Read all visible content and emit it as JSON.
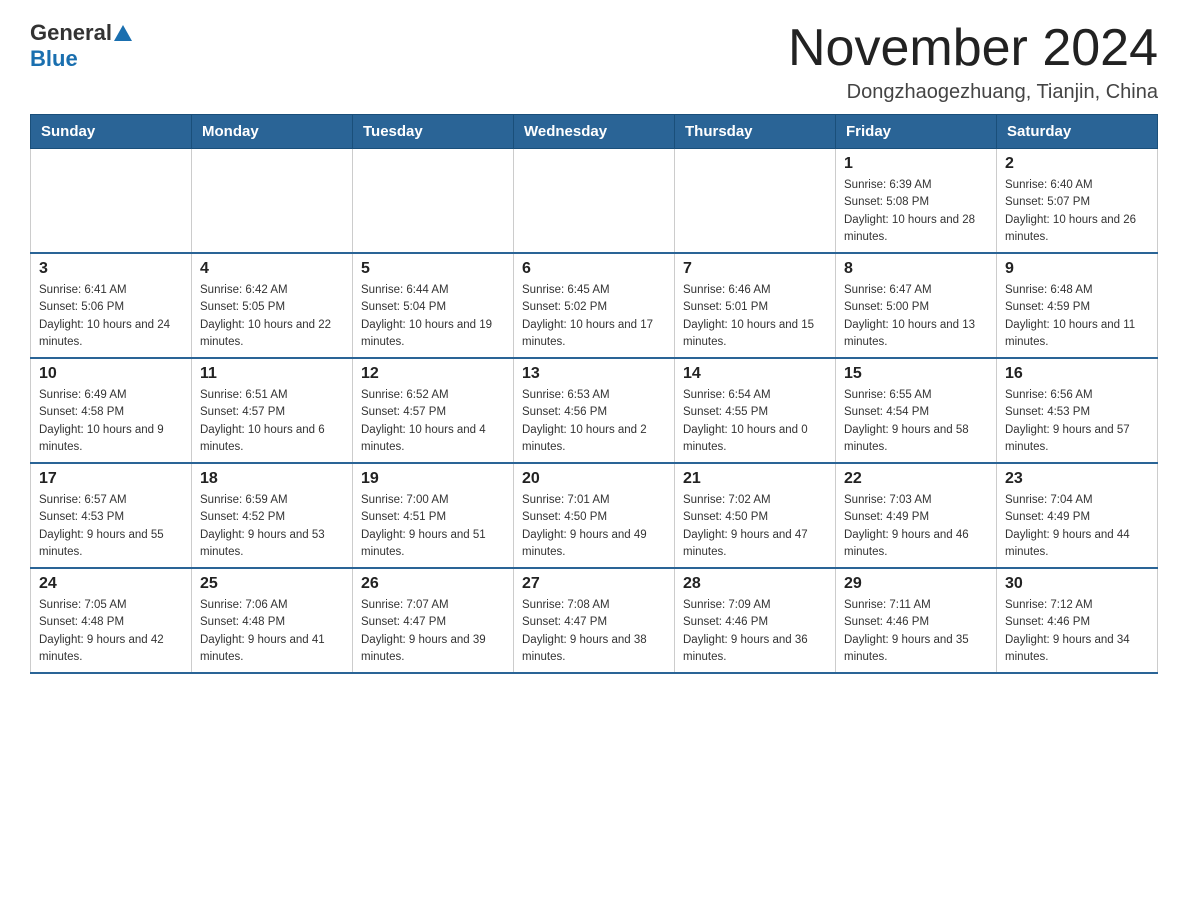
{
  "logo": {
    "general": "General",
    "blue": "Blue",
    "triangle": "▲"
  },
  "title": "November 2024",
  "location": "Dongzhaogezhuang, Tianjin, China",
  "days_of_week": [
    "Sunday",
    "Monday",
    "Tuesday",
    "Wednesday",
    "Thursday",
    "Friday",
    "Saturday"
  ],
  "weeks": [
    [
      {
        "day": "",
        "info": ""
      },
      {
        "day": "",
        "info": ""
      },
      {
        "day": "",
        "info": ""
      },
      {
        "day": "",
        "info": ""
      },
      {
        "day": "",
        "info": ""
      },
      {
        "day": "1",
        "info": "Sunrise: 6:39 AM\nSunset: 5:08 PM\nDaylight: 10 hours and 28 minutes."
      },
      {
        "day": "2",
        "info": "Sunrise: 6:40 AM\nSunset: 5:07 PM\nDaylight: 10 hours and 26 minutes."
      }
    ],
    [
      {
        "day": "3",
        "info": "Sunrise: 6:41 AM\nSunset: 5:06 PM\nDaylight: 10 hours and 24 minutes."
      },
      {
        "day": "4",
        "info": "Sunrise: 6:42 AM\nSunset: 5:05 PM\nDaylight: 10 hours and 22 minutes."
      },
      {
        "day": "5",
        "info": "Sunrise: 6:44 AM\nSunset: 5:04 PM\nDaylight: 10 hours and 19 minutes."
      },
      {
        "day": "6",
        "info": "Sunrise: 6:45 AM\nSunset: 5:02 PM\nDaylight: 10 hours and 17 minutes."
      },
      {
        "day": "7",
        "info": "Sunrise: 6:46 AM\nSunset: 5:01 PM\nDaylight: 10 hours and 15 minutes."
      },
      {
        "day": "8",
        "info": "Sunrise: 6:47 AM\nSunset: 5:00 PM\nDaylight: 10 hours and 13 minutes."
      },
      {
        "day": "9",
        "info": "Sunrise: 6:48 AM\nSunset: 4:59 PM\nDaylight: 10 hours and 11 minutes."
      }
    ],
    [
      {
        "day": "10",
        "info": "Sunrise: 6:49 AM\nSunset: 4:58 PM\nDaylight: 10 hours and 9 minutes."
      },
      {
        "day": "11",
        "info": "Sunrise: 6:51 AM\nSunset: 4:57 PM\nDaylight: 10 hours and 6 minutes."
      },
      {
        "day": "12",
        "info": "Sunrise: 6:52 AM\nSunset: 4:57 PM\nDaylight: 10 hours and 4 minutes."
      },
      {
        "day": "13",
        "info": "Sunrise: 6:53 AM\nSunset: 4:56 PM\nDaylight: 10 hours and 2 minutes."
      },
      {
        "day": "14",
        "info": "Sunrise: 6:54 AM\nSunset: 4:55 PM\nDaylight: 10 hours and 0 minutes."
      },
      {
        "day": "15",
        "info": "Sunrise: 6:55 AM\nSunset: 4:54 PM\nDaylight: 9 hours and 58 minutes."
      },
      {
        "day": "16",
        "info": "Sunrise: 6:56 AM\nSunset: 4:53 PM\nDaylight: 9 hours and 57 minutes."
      }
    ],
    [
      {
        "day": "17",
        "info": "Sunrise: 6:57 AM\nSunset: 4:53 PM\nDaylight: 9 hours and 55 minutes."
      },
      {
        "day": "18",
        "info": "Sunrise: 6:59 AM\nSunset: 4:52 PM\nDaylight: 9 hours and 53 minutes."
      },
      {
        "day": "19",
        "info": "Sunrise: 7:00 AM\nSunset: 4:51 PM\nDaylight: 9 hours and 51 minutes."
      },
      {
        "day": "20",
        "info": "Sunrise: 7:01 AM\nSunset: 4:50 PM\nDaylight: 9 hours and 49 minutes."
      },
      {
        "day": "21",
        "info": "Sunrise: 7:02 AM\nSunset: 4:50 PM\nDaylight: 9 hours and 47 minutes."
      },
      {
        "day": "22",
        "info": "Sunrise: 7:03 AM\nSunset: 4:49 PM\nDaylight: 9 hours and 46 minutes."
      },
      {
        "day": "23",
        "info": "Sunrise: 7:04 AM\nSunset: 4:49 PM\nDaylight: 9 hours and 44 minutes."
      }
    ],
    [
      {
        "day": "24",
        "info": "Sunrise: 7:05 AM\nSunset: 4:48 PM\nDaylight: 9 hours and 42 minutes."
      },
      {
        "day": "25",
        "info": "Sunrise: 7:06 AM\nSunset: 4:48 PM\nDaylight: 9 hours and 41 minutes."
      },
      {
        "day": "26",
        "info": "Sunrise: 7:07 AM\nSunset: 4:47 PM\nDaylight: 9 hours and 39 minutes."
      },
      {
        "day": "27",
        "info": "Sunrise: 7:08 AM\nSunset: 4:47 PM\nDaylight: 9 hours and 38 minutes."
      },
      {
        "day": "28",
        "info": "Sunrise: 7:09 AM\nSunset: 4:46 PM\nDaylight: 9 hours and 36 minutes."
      },
      {
        "day": "29",
        "info": "Sunrise: 7:11 AM\nSunset: 4:46 PM\nDaylight: 9 hours and 35 minutes."
      },
      {
        "day": "30",
        "info": "Sunrise: 7:12 AM\nSunset: 4:46 PM\nDaylight: 9 hours and 34 minutes."
      }
    ]
  ]
}
